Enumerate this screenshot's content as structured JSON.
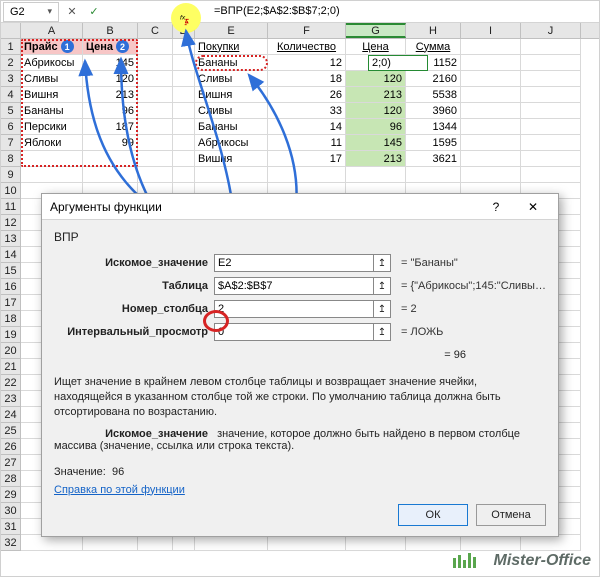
{
  "namebox": {
    "cell_ref": "G2"
  },
  "formula_bar": {
    "formula": "=ВПР(E2;$A$2:$B$7;2;0)"
  },
  "columns": [
    "A",
    "B",
    "C",
    "D",
    "E",
    "F",
    "G",
    "H",
    "I",
    "J"
  ],
  "row_headers": [
    "1",
    "2",
    "3",
    "4",
    "5",
    "6",
    "7",
    "8",
    "9",
    "10",
    "11",
    "12",
    "13",
    "14",
    "15",
    "16",
    "17",
    "18",
    "19",
    "20",
    "21",
    "22",
    "23",
    "24",
    "25",
    "26",
    "27",
    "28",
    "29",
    "30",
    "31",
    "32"
  ],
  "left_table": {
    "hdr_price": "Прайс",
    "hdr_cost": "Цена",
    "circ1": "1",
    "circ2": "2",
    "rows": [
      {
        "name": "Абрикосы",
        "price": "145"
      },
      {
        "name": "Сливы",
        "price": "120"
      },
      {
        "name": "Вишня",
        "price": "213"
      },
      {
        "name": "Бананы",
        "price": "96"
      },
      {
        "name": "Персики",
        "price": "187"
      },
      {
        "name": "Яблоки",
        "price": "99"
      }
    ]
  },
  "right_table": {
    "hdr_buy": "Покупки",
    "hdr_qty": "Количество",
    "hdr_cost": "Цена",
    "hdr_sum": "Сумма",
    "active_display": "2;0)",
    "rows": [
      {
        "name": "Бананы",
        "qty": "12",
        "price": "",
        "sum": "1152"
      },
      {
        "name": "Сливы",
        "qty": "18",
        "price": "120",
        "sum": "2160"
      },
      {
        "name": "Вишня",
        "qty": "26",
        "price": "213",
        "sum": "5538"
      },
      {
        "name": "Сливы",
        "qty": "33",
        "price": "120",
        "sum": "3960"
      },
      {
        "name": "Бананы",
        "qty": "14",
        "price": "96",
        "sum": "1344"
      },
      {
        "name": "Абрикосы",
        "qty": "11",
        "price": "145",
        "sum": "1595"
      },
      {
        "name": "Вишня",
        "qty": "17",
        "price": "213",
        "sum": "3621"
      }
    ]
  },
  "dialog": {
    "title": "Аргументы функции",
    "fn": "ВПР",
    "args": {
      "lookup_label": "Искомое_значение",
      "lookup_val": "E2",
      "lookup_res": "= \"Бананы\"",
      "table_label": "Таблица",
      "table_val": "$A$2:$B$7",
      "table_res": "= {\"Абрикосы\";145:\"Сливы\";120:\"В...",
      "col_label": "Номер_столбца",
      "col_val": "2",
      "col_res": "= 2",
      "range_label": "Интервальный_просмотр",
      "range_val": "0",
      "range_res": "= ЛОЖЬ"
    },
    "result_eq": "= 96",
    "desc": "Ищет значение в крайнем левом столбце таблицы и возвращает значение ячейки, находящейся в указанном столбце той же строки. По умолчанию таблица должна быть отсортирована по возрастанию.",
    "desc_arg_label": "Искомое_значение",
    "desc_arg_text": "значение, которое должно быть найдено в первом столбце массива (значение, ссылка или строка текста).",
    "value_label": "Значение:",
    "value_val": "96",
    "help_link": "Справка по этой функции",
    "ok": "ОК",
    "cancel": "Отмена"
  },
  "watermark": "Mister-Office"
}
